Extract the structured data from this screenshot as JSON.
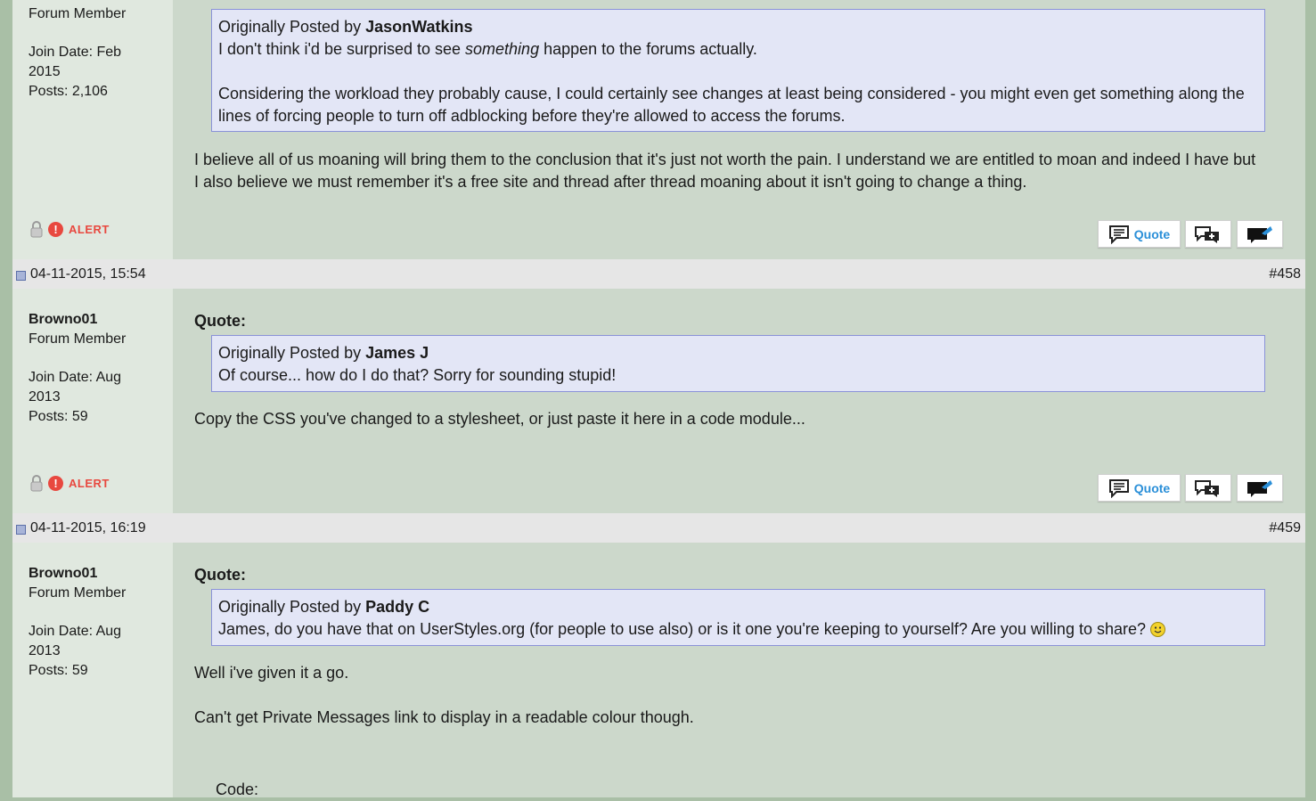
{
  "posts": [
    {
      "user": {
        "title": "Forum Member",
        "join": "Join Date: Feb",
        "join_year": "2015",
        "posts": "Posts: 2,106"
      },
      "alert_label": "ALERT",
      "quote": {
        "by_prefix": "Originally Posted by",
        "author": "JasonWatkins",
        "line1_pre": "I don't think i'd be surprised to see ",
        "line1_em": "something",
        "line1_post": " happen to the forums actually.",
        "para2": "Considering the workload they probably cause, I could certainly see changes at least being considered - you might even get something along the lines of forcing people to turn off adblocking before they're allowed to access the forums."
      },
      "body": "I believe all of us moaning will bring them to the conclusion that it's just not worth the pain. I understand we are entitled to moan and indeed I have but I also believe we must remember it's a free site and thread after thread moaning about it isn't going to change a thing.",
      "quote_btn": "Quote"
    },
    {
      "date": "04-11-2015, 15:54",
      "number": "#458",
      "user": {
        "name": "Browno01",
        "title": "Forum Member",
        "join": "Join Date: Aug",
        "join_year": "2013",
        "posts": "Posts: 59"
      },
      "quote_label": "Quote:",
      "quote": {
        "by_prefix": "Originally Posted by",
        "author": "James J",
        "text": "Of course... how do I do that? Sorry for sounding stupid!"
      },
      "body": "Copy the CSS you've changed to a stylesheet, or just paste it here in a code module...",
      "alert_label": "ALERT",
      "quote_btn": "Quote"
    },
    {
      "date": "04-11-2015, 16:19",
      "number": "#459",
      "user": {
        "name": "Browno01",
        "title": "Forum Member",
        "join": "Join Date: Aug",
        "join_year": "2013",
        "posts": "Posts: 59"
      },
      "quote_label": "Quote:",
      "quote": {
        "by_prefix": "Originally Posted by",
        "author": "Paddy C",
        "text": "James, do you have that on UserStyles.org (for people to use also) or is it one you're keeping to yourself? Are you willing to share?"
      },
      "body1": "Well i've given it a go.",
      "body2": "Can't get Private Messages link to display in a readable colour though.",
      "code_label": "Code:"
    }
  ],
  "colors": {
    "alert": "#e8483f",
    "quote_link": "#2a8fd8",
    "quote_bg": "#e3e6f6",
    "post_bg": "#ccd8cb"
  }
}
